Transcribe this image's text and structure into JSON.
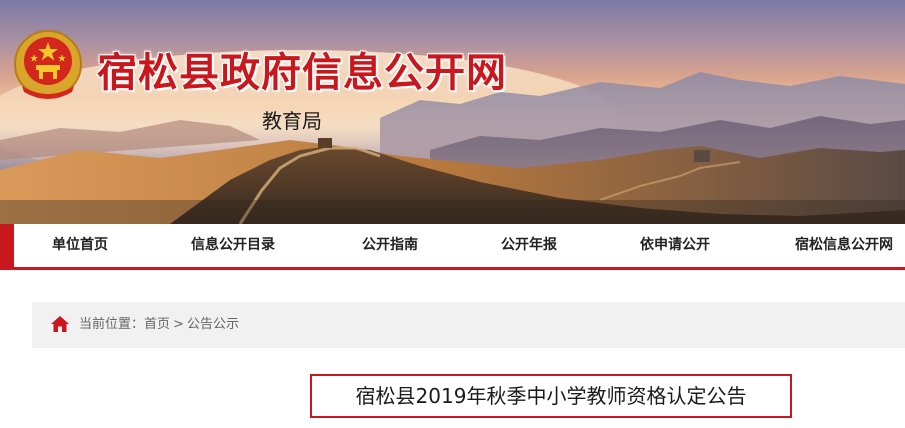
{
  "header": {
    "site_title": "宿松县政府信息公开网",
    "department": "教育局",
    "emblem_icon": "national-emblem-icon"
  },
  "nav": {
    "items": [
      {
        "label": "单位首页"
      },
      {
        "label": "信息公开目录"
      },
      {
        "label": "公开指南"
      },
      {
        "label": "公开年报"
      },
      {
        "label": "依申请公开"
      },
      {
        "label": "宿松信息公开网"
      }
    ]
  },
  "breadcrumb": {
    "prefix": "当前位置：",
    "items": [
      "首页",
      "公告公示"
    ],
    "separator": ">",
    "icon": "home-icon"
  },
  "article": {
    "title": "宿松县2019年秋季中小学教师资格认定公告"
  },
  "colors": {
    "accent_red": "#c8181e",
    "breadcrumb_bg": "#f1f1f1"
  }
}
